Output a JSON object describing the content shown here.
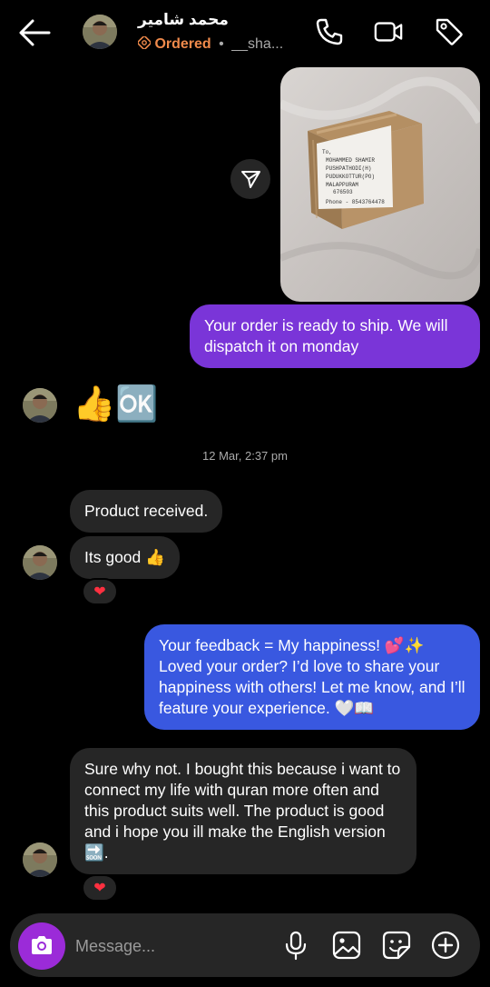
{
  "header": {
    "name": "محمد شامير",
    "status": "Ordered",
    "separator": "•",
    "username": "__sha..."
  },
  "thread": {
    "msg1": "Your order is ready to ship. We will dispatch it on monday",
    "emoji_reply": "👍🆗",
    "timestamp": "12 Mar, 2:37 pm",
    "msg2": "Product received.",
    "msg3": "Its good 👍",
    "reaction1": "❤",
    "msg4": "Your feedback = My happiness! 💕✨ Loved your order? I’d love to share your happiness with others! Let me know, and I’ll feature your experience. 🤍📖",
    "msg5": "Sure why not. I bought this because i want to connect my life with quran more often and this product suits well. The product is good and i hope you ill make the English version 🔜.",
    "reaction2": "❤",
    "photo_label_lines": [
      "To,",
      "MOHAMMED SHAMIR",
      "PUSHPATHODI(H)",
      "PUDUKKOTTUR(PO)",
      "MALAPPURAM",
      "676503",
      "Phone - 8543764478"
    ]
  },
  "composer": {
    "placeholder": "Message..."
  },
  "colors": {
    "outgoing_purple": "#7a35d8",
    "outgoing_blue": "#3958e0",
    "incoming": "#262626",
    "status_orange": "#f08a4b",
    "camera": "#9b2bd8"
  },
  "icons": [
    "back-arrow-icon",
    "phone-icon",
    "video-camera-icon",
    "tag-icon",
    "share-icon",
    "camera-icon",
    "microphone-icon",
    "gallery-icon",
    "sticker-icon",
    "plus-circle-icon"
  ]
}
